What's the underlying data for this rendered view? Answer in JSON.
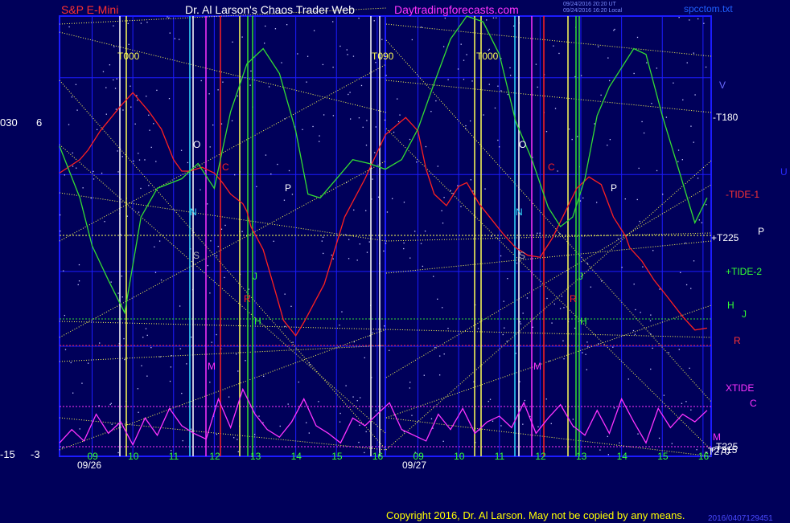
{
  "header": {
    "symbol": "S&P E-Mini",
    "title": "Dr. Al Larson's Chaos Trader Web",
    "site": "Daytradingforecasts.com",
    "timestamp1": "09/24/2016 20:20 UT",
    "timestamp2": "09/24/2016 16:20 Local",
    "filename": "spcctom.txt"
  },
  "footer": {
    "copyright": "Copyright 2016, Dr. Al Larson. May not be copied by any means.",
    "code": "2016/0407129451"
  },
  "left_axis": {
    "top_a": "030",
    "top_b": "6",
    "bottom_a": "-15",
    "bottom_b": "-3"
  },
  "dates": [
    "09/26",
    "09/27"
  ],
  "colors": {
    "background": "#00005a",
    "grid_blue": "#1c1cff",
    "red": "#ff2020",
    "green": "#33dd33",
    "magenta": "#ff33ff",
    "yellow": "#ffff55",
    "white": "#ffffff",
    "cyan": "#33ddff"
  },
  "chart_data": {
    "type": "line",
    "hours": [
      "09",
      "10",
      "11",
      "12",
      "13",
      "14",
      "15",
      "16"
    ],
    "day_markers": [
      "T000",
      "T090",
      "T000"
    ],
    "right_labels": [
      {
        "text": "V",
        "color": "#6a6aff"
      },
      {
        "text": "-T180",
        "color": "#ffffff"
      },
      {
        "text": "U",
        "color": "#2a2aff"
      },
      {
        "text": "-TIDE-1",
        "color": "#ff3333"
      },
      {
        "text": "+T225",
        "color": "#ffffff"
      },
      {
        "text": "P",
        "color": "#ffffff"
      },
      {
        "text": "+TIDE-2",
        "color": "#33ff33"
      },
      {
        "text": "H",
        "color": "#33ff33"
      },
      {
        "text": "J",
        "color": "#33ff33"
      },
      {
        "text": "R",
        "color": "#ff3333"
      },
      {
        "text": "XTIDE",
        "color": "#ff33ff"
      },
      {
        "text": "C",
        "color": "#ff33ff"
      },
      {
        "text": "M",
        "color": "#ff33ff"
      },
      {
        "text": "-T225",
        "color": "#ffffff"
      },
      {
        "text": "-T270",
        "color": "#ffffff"
      },
      {
        "text": "+T315",
        "color": "#ffffff"
      }
    ],
    "event_labels": [
      {
        "text": "O",
        "color": "#ffffff"
      },
      {
        "text": "N",
        "color": "#33ddff"
      },
      {
        "text": "S",
        "color": "#aaaaaa"
      },
      {
        "text": "C",
        "color": "#ff2020"
      },
      {
        "text": "P",
        "color": "#ffffff"
      },
      {
        "text": "J",
        "color": "#33ff33"
      },
      {
        "text": "R",
        "color": "#ff2020"
      },
      {
        "text": "H",
        "color": "#33ff33"
      },
      {
        "text": "M",
        "color": "#ff33ff"
      }
    ],
    "series": [
      {
        "name": "TIDE-1",
        "color": "#ff2020",
        "x": [
          0,
          0.5,
          0.7,
          1,
          1.5,
          1.8,
          2.2,
          2.5,
          2.8,
          3,
          3.2,
          3.5,
          3.8,
          4,
          4.2,
          4.5,
          4.6,
          4.7,
          5,
          5.3,
          5.5,
          5.8,
          6,
          6.5,
          7,
          7.5,
          8,
          8.5,
          8.8,
          9,
          9.2,
          9.5,
          9.8,
          10,
          10.3,
          10.6,
          10.9,
          11.2,
          11.5,
          11.8,
          12.1,
          12.4,
          12.7,
          13,
          13.3,
          13.6,
          13.9,
          14,
          14.3,
          14.6,
          14.9,
          15.3,
          15.6,
          15.9
        ],
        "y": [
          0.8,
          1.5,
          2.0,
          3.0,
          4.3,
          5.0,
          4.0,
          3.1,
          1.5,
          0.9,
          0.9,
          1.1,
          0.8,
          0.3,
          -0.3,
          -0.8,
          -1.2,
          -2.0,
          -3.2,
          -5.4,
          -6.9,
          -7.7,
          -7.0,
          -5.0,
          -1.5,
          0.5,
          2.8,
          3.7,
          3.0,
          1.0,
          -0.3,
          -0.9,
          0.1,
          0.3,
          -0.8,
          -1.6,
          -2.4,
          -3.1,
          -3.5,
          -3.6,
          -2.6,
          -1.3,
          0.0,
          0.6,
          0.2,
          -1.5,
          -2.5,
          -3.1,
          -3.8,
          -4.8,
          -5.6,
          -6.7,
          -7.4,
          -7.3
        ]
      },
      {
        "name": "TIDE-2",
        "color": "#33dd33",
        "x": [
          0,
          0.5,
          0.8,
          1.2,
          1.6,
          2.0,
          2.4,
          3.0,
          3.4,
          3.8,
          4.2,
          4.6,
          5.0,
          5.4,
          5.8,
          6.1,
          6.4,
          6.8,
          7.2,
          7.6,
          8.0,
          8.4,
          8.8,
          9.2,
          9.6,
          10.0,
          10.4,
          10.8,
          11.2,
          11.6,
          12.0,
          12.3,
          12.6,
          12.9,
          13.2,
          13.5,
          13.8,
          14.1,
          14.4,
          14.8,
          15.2,
          15.6,
          15.9
        ],
        "y": [
          2.2,
          -0.5,
          -3.0,
          -4.8,
          -6.5,
          -1.5,
          0.0,
          0.5,
          1.3,
          0.0,
          4.0,
          6.5,
          7.3,
          6.0,
          3.0,
          -0.3,
          -0.5,
          0.5,
          1.5,
          1.3,
          1.0,
          1.5,
          3.1,
          5.5,
          7.8,
          9.0,
          8.7,
          7.0,
          3.5,
          1.5,
          -1.0,
          -2.0,
          -1.5,
          0.5,
          3.8,
          5.3,
          6.3,
          7.3,
          7.0,
          3.8,
          1.0,
          -1.8,
          -0.5
        ]
      },
      {
        "name": "XTIDE",
        "color": "#ff33ff",
        "x": [
          0,
          0.3,
          0.6,
          0.9,
          1.2,
          1.5,
          1.8,
          2.1,
          2.4,
          2.7,
          3.0,
          3.3,
          3.6,
          3.9,
          4.2,
          4.5,
          4.8,
          5.1,
          5.4,
          5.7,
          6.0,
          6.3,
          6.6,
          6.9,
          7.2,
          7.5,
          7.8,
          8.1,
          8.4,
          8.7,
          9.0,
          9.3,
          9.6,
          9.9,
          10.2,
          10.5,
          10.8,
          11.1,
          11.4,
          11.7,
          12.0,
          12.3,
          12.6,
          12.9,
          13.2,
          13.5,
          13.8,
          14.1,
          14.4,
          14.7,
          15.0,
          15.3,
          15.6,
          15.9
        ],
        "y": [
          -13.3,
          -12.6,
          -13.2,
          -11.8,
          -12.8,
          -12.2,
          -13.4,
          -12.0,
          -12.9,
          -11.5,
          -12.4,
          -12.8,
          -13.1,
          -11.0,
          -12.5,
          -10.5,
          -11.8,
          -12.6,
          -13.0,
          -12.2,
          -11.0,
          -12.4,
          -12.8,
          -13.3,
          -12.0,
          -12.4,
          -11.8,
          -11.2,
          -12.6,
          -12.9,
          -13.2,
          -11.8,
          -12.6,
          -11.5,
          -12.8,
          -12.2,
          -11.9,
          -12.5,
          -11.2,
          -12.8,
          -12.0,
          -11.3,
          -12.4,
          -12.9,
          -11.6,
          -12.8,
          -11.0,
          -12.2,
          -13.3,
          -11.5,
          -12.5,
          -11.8,
          -12.2,
          -11.6
        ]
      }
    ],
    "xlim": [
      0,
      16
    ],
    "ylim": [
      -14,
      9
    ],
    "grid": true
  }
}
